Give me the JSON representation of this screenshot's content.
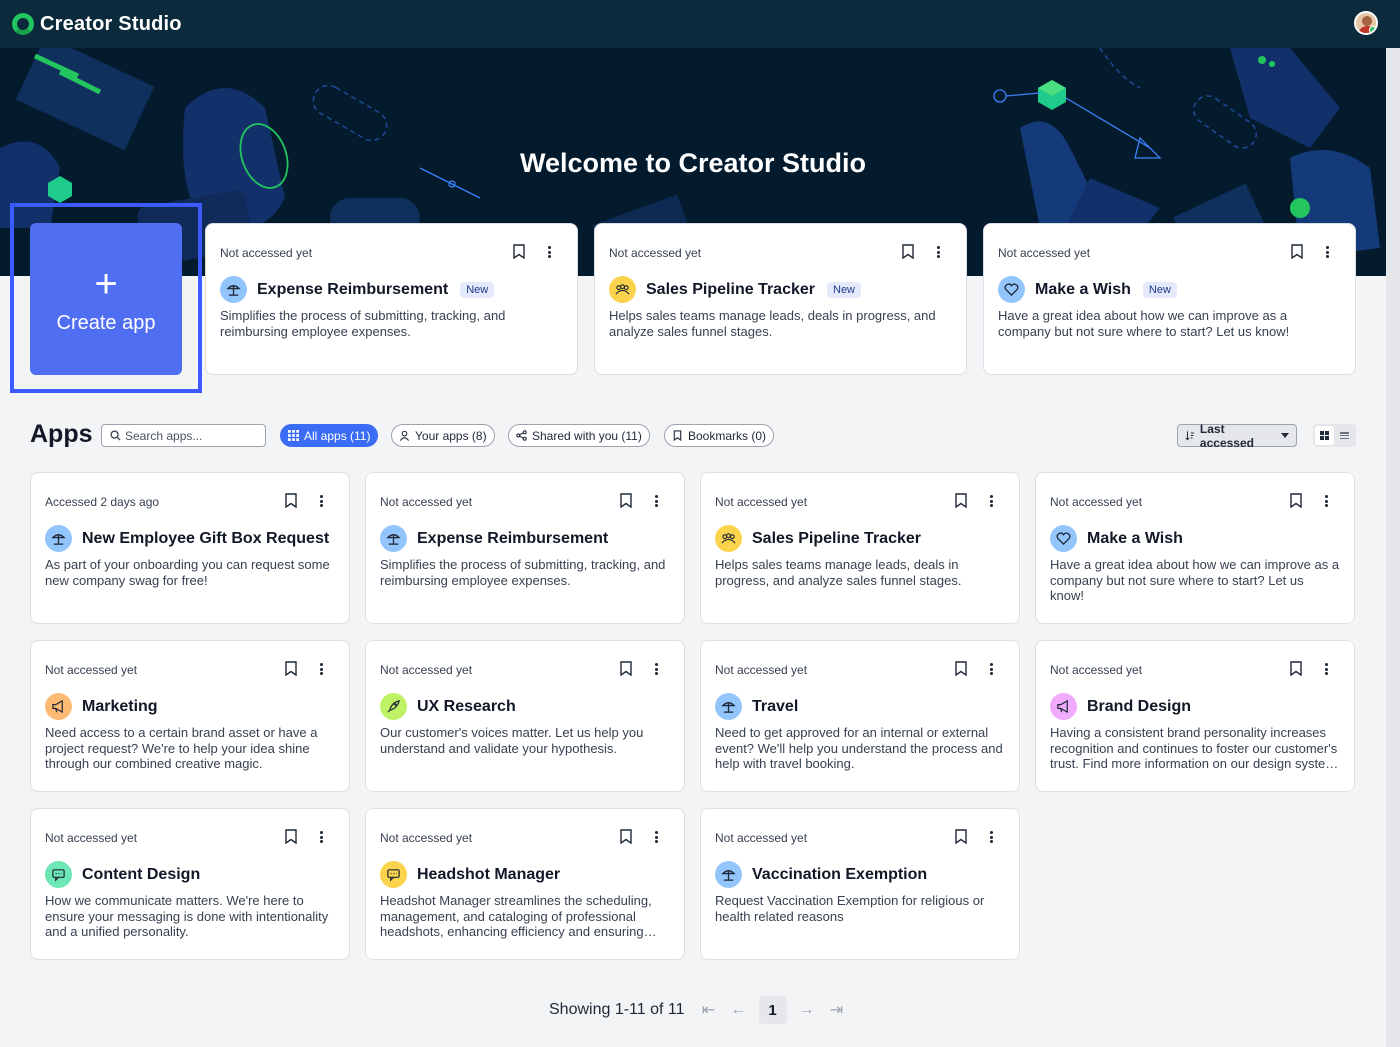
{
  "topbar": {
    "brand": "Creator Studio"
  },
  "hero": {
    "title": "Welcome to Creator Studio"
  },
  "create_app": {
    "label": "Create app",
    "plus": "+"
  },
  "featured": [
    {
      "accessed": "Not accessed yet",
      "name": "Expense Reimbursement",
      "badge": "New",
      "description": "Simplifies the process of submitting, tracking, and reimbursing employee expenses.",
      "icon": "travel-icon",
      "icon_bg": "#93c5fd"
    },
    {
      "accessed": "Not accessed yet",
      "name": "Sales Pipeline Tracker",
      "badge": "New",
      "description": "Helps sales teams manage leads, deals in progress, and analyze sales funnel stages.",
      "icon": "team-icon",
      "icon_bg": "#fcd34d"
    },
    {
      "accessed": "Not accessed yet",
      "name": "Make a Wish",
      "badge": "New",
      "description": "Have a great idea about how we can improve as a company but not sure where to start? Let us know!",
      "icon": "heart-icon",
      "icon_bg": "#93c5fd"
    }
  ],
  "apps_section": {
    "title": "Apps",
    "search_placeholder": "Search apps...",
    "filters": [
      {
        "label": "All apps (11)",
        "icon": "grid-icon",
        "active": true
      },
      {
        "label": "Your apps (8)",
        "icon": "user-icon",
        "active": false
      },
      {
        "label": "Shared with you (11)",
        "icon": "share-icon",
        "active": false
      },
      {
        "label": "Bookmarks (0)",
        "icon": "bookmark-icon",
        "active": false
      }
    ],
    "sort_label": "Last accessed"
  },
  "apps": [
    {
      "accessed": "Accessed 2 days ago",
      "name": "New Employee Gift Box Request",
      "description": "As part of your onboarding you can request some new company swag for free!",
      "icon": "travel-icon",
      "icon_bg": "#93c5fd"
    },
    {
      "accessed": "Not accessed yet",
      "name": "Expense Reimbursement",
      "description": "Simplifies the process of submitting, tracking, and reimbursing employee expenses.",
      "icon": "travel-icon",
      "icon_bg": "#93c5fd"
    },
    {
      "accessed": "Not accessed yet",
      "name": "Sales Pipeline Tracker",
      "description": "Helps sales teams manage leads, deals in progress, and analyze sales funnel stages.",
      "icon": "team-icon",
      "icon_bg": "#fcd34d"
    },
    {
      "accessed": "Not accessed yet",
      "name": "Make a Wish",
      "description": "Have a great idea about how we can improve as a company but not sure where to start? Let us know!",
      "icon": "heart-icon",
      "icon_bg": "#93c5fd"
    },
    {
      "accessed": "Not accessed yet",
      "name": "Marketing",
      "description": "Need access to a certain brand asset or have a project request? We're to help your idea shine through our combined creative magic.",
      "icon": "megaphone-icon",
      "icon_bg": "#fdba74"
    },
    {
      "accessed": "Not accessed yet",
      "name": "UX Research",
      "description": "Our customer's voices matter. Let us help you understand and validate your hypothesis.",
      "icon": "rocket-icon",
      "icon_bg": "#bef264"
    },
    {
      "accessed": "Not accessed yet",
      "name": "Travel",
      "description": "Need to get approved for an internal or external event? We'll help you understand the process and help with travel booking.",
      "icon": "travel-icon",
      "icon_bg": "#93c5fd"
    },
    {
      "accessed": "Not accessed yet",
      "name": "Brand Design",
      "description": "Having a consistent brand personality increases recognition and continues to foster our customer's trust. Find more information on our design system and visual guidelines.",
      "icon": "megaphone-icon",
      "icon_bg": "#f0abfc"
    },
    {
      "accessed": "Not accessed yet",
      "name": "Content Design",
      "description": "How we communicate matters. We're here to ensure your messaging is done with intentionality and a unified personality.",
      "icon": "chat-icon",
      "icon_bg": "#6ee7b7"
    },
    {
      "accessed": "Not accessed yet",
      "name": "Headshot Manager",
      "description": "Headshot Manager streamlines the scheduling, management, and cataloging of professional headshots, enhancing efficiency and ensuring consistent quality.",
      "icon": "chat-icon",
      "icon_bg": "#fcd34d"
    },
    {
      "accessed": "Not accessed yet",
      "name": "Vaccination Exemption",
      "description": "Request Vaccination Exemption for religious or health related reasons",
      "icon": "travel-icon",
      "icon_bg": "#93c5fd"
    }
  ],
  "pagination": {
    "summary": "Showing 1-11 of 11",
    "current_page": "1"
  }
}
